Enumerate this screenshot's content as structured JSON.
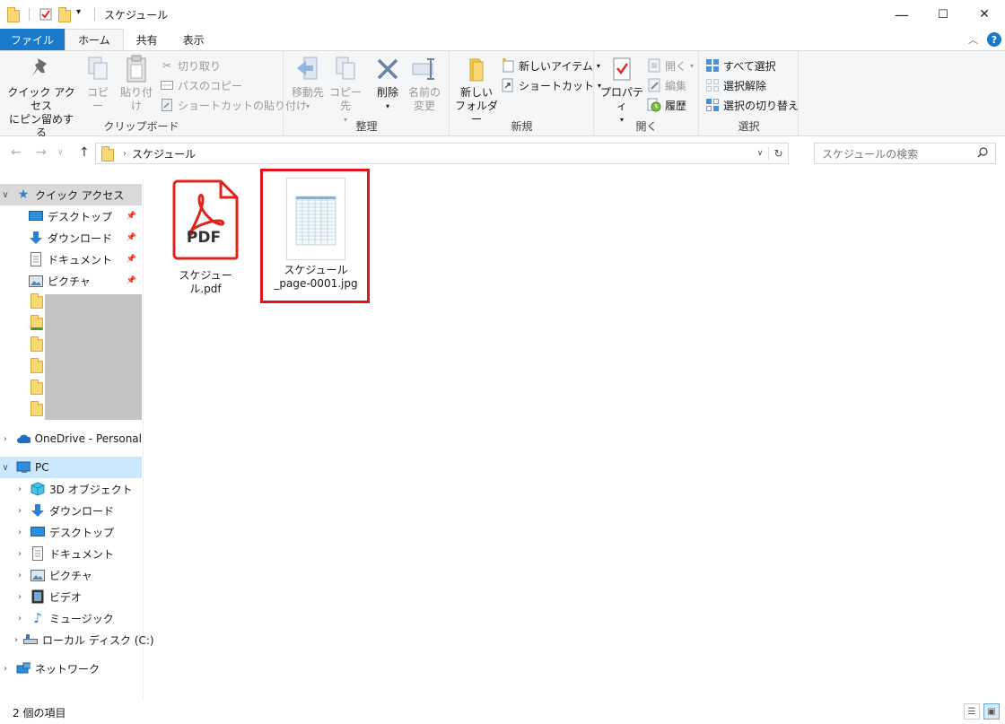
{
  "window": {
    "title": "スケジュール",
    "minimize": "—",
    "maximize": "☐",
    "close": "✕"
  },
  "tabs": {
    "file": "ファイル",
    "home": "ホーム",
    "share": "共有",
    "view": "表示"
  },
  "ribbon": {
    "clipboard": {
      "label": "クリップボード",
      "pin_quick": "クイック アクセス\nにピン留めする",
      "copy": "コピー",
      "paste": "貼り付け",
      "cut": "切り取り",
      "copy_path": "パスのコピー",
      "paste_shortcut": "ショートカットの貼り付け"
    },
    "organize": {
      "label": "整理",
      "move_to": "移動先",
      "copy_to": "コピー先",
      "delete": "削除",
      "rename": "名前の\n変更"
    },
    "new": {
      "label": "新規",
      "new_folder": "新しい\nフォルダー",
      "new_item": "新しいアイテム",
      "shortcut": "ショートカット"
    },
    "open": {
      "label": "開く",
      "properties": "プロパティ",
      "open": "開く",
      "edit": "編集",
      "history": "履歴"
    },
    "select": {
      "label": "選択",
      "select_all": "すべて選択",
      "select_none": "選択解除",
      "invert": "選択の切り替え"
    }
  },
  "address": {
    "path": "スケジュール",
    "search_placeholder": "スケジュールの検索"
  },
  "nav": {
    "quick_access": "クイック アクセス",
    "qa_items": [
      "デスクトップ",
      "ダウンロード",
      "ドキュメント",
      "ピクチャ"
    ],
    "onedrive": "OneDrive - Personal",
    "pc": "PC",
    "pc_items": [
      "3D オブジェクト",
      "ダウンロード",
      "デスクトップ",
      "ドキュメント",
      "ピクチャ",
      "ビデオ",
      "ミュージック",
      "ローカル ディスク (C:)"
    ],
    "network": "ネットワーク"
  },
  "files": [
    {
      "name": "スケジュール.pdf",
      "icon": "pdf-icon",
      "badge": "PDF"
    },
    {
      "name": "スケジュール\n_page-0001.jpg",
      "icon": "image-thumbnail",
      "selected": true
    }
  ],
  "status": {
    "count": "2 個の項目"
  },
  "colors": {
    "accent": "#1979ca",
    "selection_border": "#e0141e",
    "pdf_red": "#e0241b"
  }
}
